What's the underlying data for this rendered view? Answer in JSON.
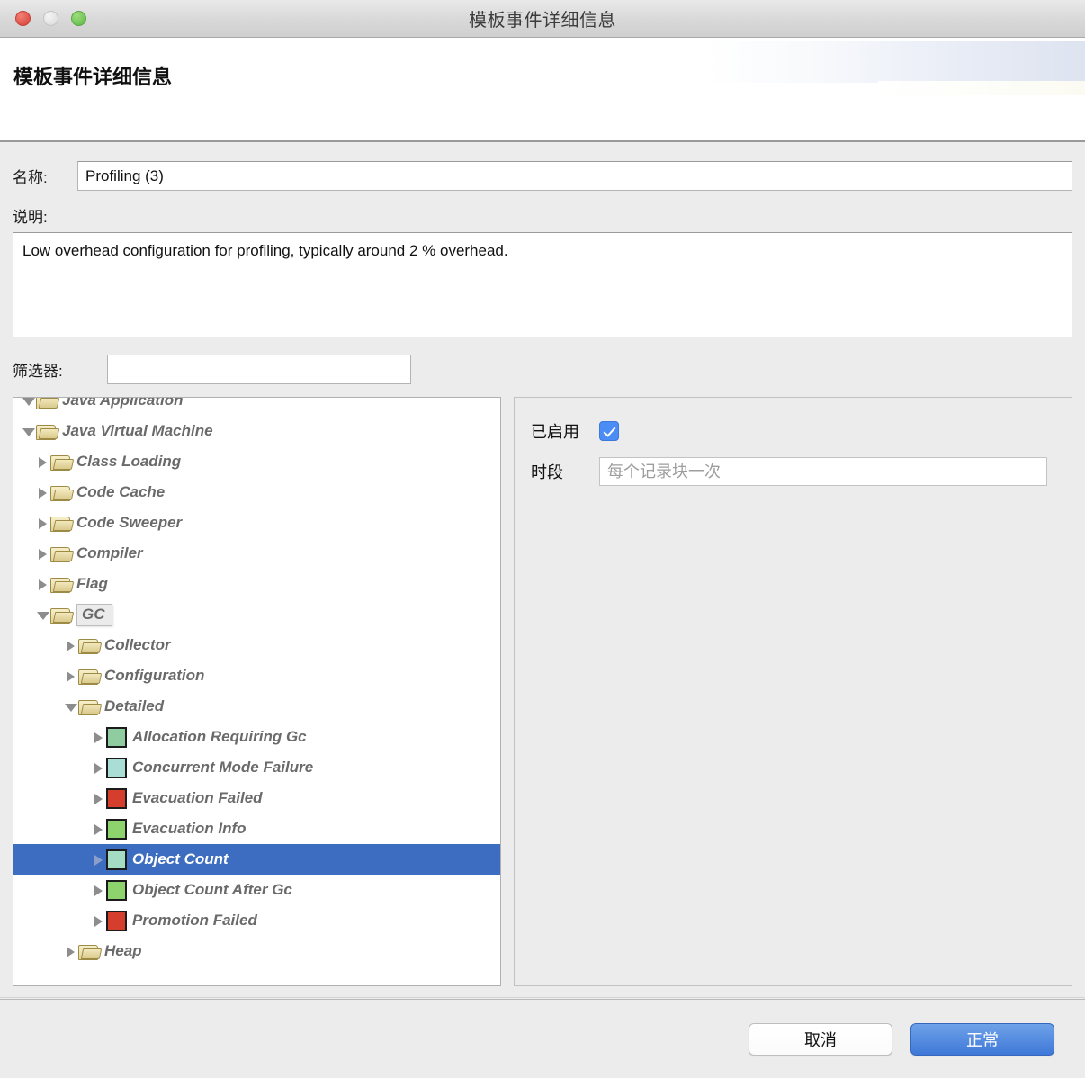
{
  "window": {
    "title": "模板事件详细信息",
    "traffic_lights": [
      "close-button",
      "minimize-button",
      "zoom-button"
    ]
  },
  "banner": {
    "heading": "模板事件详细信息"
  },
  "form": {
    "name_label": "名称:",
    "name_value": "Profiling (3)",
    "description_label": "说明:",
    "description_value": "Low overhead configuration for profiling, typically around 2 % overhead.",
    "filter_label": "筛选器:",
    "filter_value": "",
    "filter_placeholder": ""
  },
  "tree": {
    "nodes": [
      {
        "label": "Java Application",
        "indent": 0,
        "icon": "folder-open-icon",
        "state": "expanded",
        "selected": false,
        "clipped": true
      },
      {
        "label": "Java Virtual Machine",
        "indent": 0,
        "icon": "folder-open-icon",
        "state": "expanded",
        "selected": false
      },
      {
        "label": "Class Loading",
        "indent": 1,
        "icon": "folder-open-icon",
        "state": "collapsed",
        "selected": false
      },
      {
        "label": "Code Cache",
        "indent": 1,
        "icon": "folder-open-icon",
        "state": "collapsed",
        "selected": false
      },
      {
        "label": "Code Sweeper",
        "indent": 1,
        "icon": "folder-open-icon",
        "state": "collapsed",
        "selected": false
      },
      {
        "label": "Compiler",
        "indent": 1,
        "icon": "folder-open-icon",
        "state": "collapsed",
        "selected": false
      },
      {
        "label": "Flag",
        "indent": 1,
        "icon": "folder-open-icon",
        "state": "collapsed",
        "selected": false
      },
      {
        "label": "GC",
        "indent": 1,
        "icon": "folder-open-icon",
        "state": "expanded",
        "selected": false,
        "tooltip": true
      },
      {
        "label": "Collector",
        "indent": 2,
        "icon": "folder-open-icon",
        "state": "collapsed",
        "selected": false
      },
      {
        "label": "Configuration",
        "indent": 2,
        "icon": "folder-open-icon",
        "state": "collapsed",
        "selected": false
      },
      {
        "label": "Detailed",
        "indent": 2,
        "icon": "folder-open-icon",
        "state": "expanded",
        "selected": false
      },
      {
        "label": "Allocation Requiring Gc",
        "indent": 3,
        "icon": "event-swatch",
        "swatch": "#8fcc9f",
        "state": "collapsed",
        "selected": false
      },
      {
        "label": "Concurrent Mode Failure",
        "indent": 3,
        "icon": "event-swatch",
        "swatch": "#a9ddd6",
        "state": "collapsed",
        "selected": false
      },
      {
        "label": "Evacuation Failed",
        "indent": 3,
        "icon": "event-swatch",
        "swatch": "#d53e2c",
        "state": "collapsed",
        "selected": false
      },
      {
        "label": "Evacuation Info",
        "indent": 3,
        "icon": "event-swatch",
        "swatch": "#8ed46e",
        "state": "collapsed",
        "selected": false
      },
      {
        "label": "Object Count",
        "indent": 3,
        "icon": "event-swatch",
        "swatch": "#a4dcc4",
        "state": "collapsed",
        "selected": true
      },
      {
        "label": "Object Count After Gc",
        "indent": 3,
        "icon": "event-swatch",
        "swatch": "#8ed46e",
        "state": "collapsed",
        "selected": false
      },
      {
        "label": "Promotion Failed",
        "indent": 3,
        "icon": "event-swatch",
        "swatch": "#d53e2c",
        "state": "collapsed",
        "selected": false
      },
      {
        "label": "Heap",
        "indent": 2,
        "icon": "folder-open-icon",
        "state": "collapsed",
        "selected": false
      }
    ]
  },
  "details": {
    "enabled_label": "已启用",
    "enabled_checked": true,
    "period_label": "时段",
    "period_value": "",
    "period_placeholder": "每个记录块一次"
  },
  "footer": {
    "cancel_label": "取消",
    "ok_label": "正常"
  },
  "colors": {
    "selection_blue": "#3d6dc0",
    "ok_button_blue": "#3f78d8",
    "checkbox_blue": "#4b8cf5",
    "dialog_gray": "#ececec"
  }
}
